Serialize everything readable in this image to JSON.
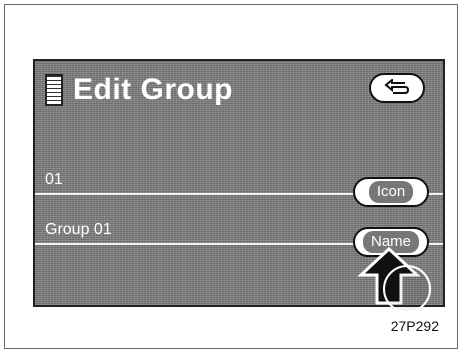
{
  "screen": {
    "title": "Edit Group",
    "icons": {
      "title": "document-icon",
      "back": "back-arrow-icon"
    }
  },
  "rows": [
    {
      "label": "01",
      "button": "Icon"
    },
    {
      "label": "Group 01",
      "button": "Name"
    }
  ],
  "figure_code": "27P292"
}
